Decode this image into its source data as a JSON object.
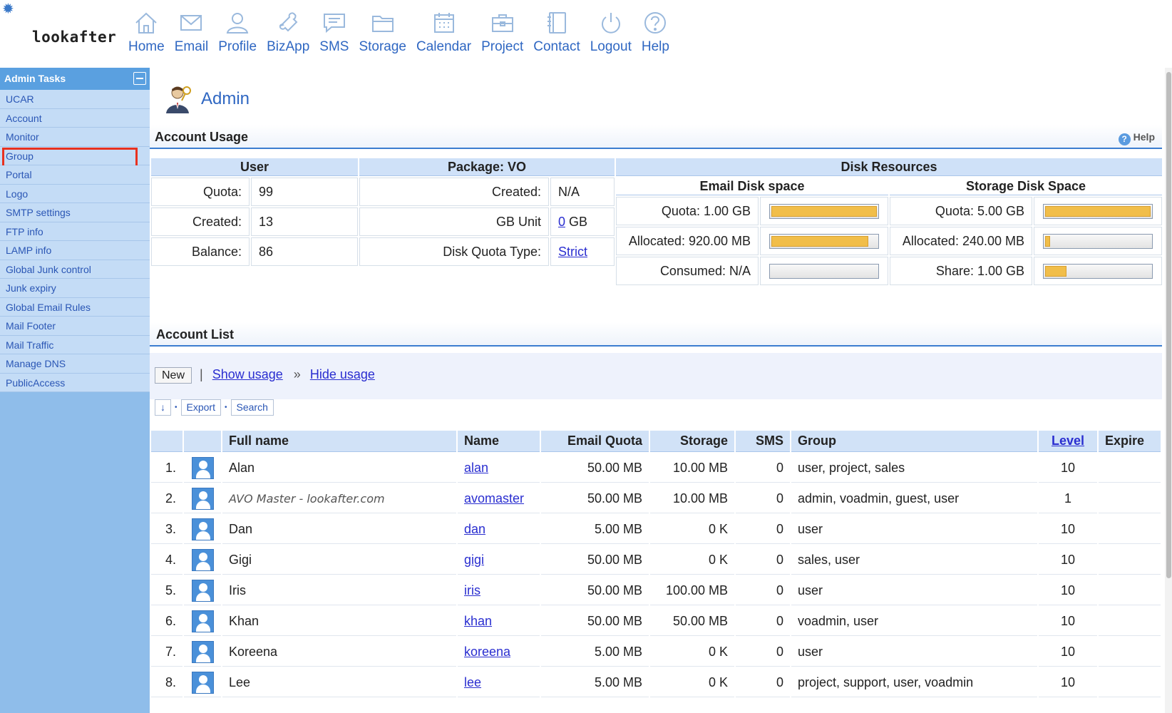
{
  "app": {
    "logo": "lookafter"
  },
  "nav": [
    {
      "label": "Home",
      "icon": "home-icon"
    },
    {
      "label": "Email",
      "icon": "envelope-icon"
    },
    {
      "label": "Profile",
      "icon": "user-icon"
    },
    {
      "label": "BizApp",
      "icon": "puzzle-icon"
    },
    {
      "label": "SMS",
      "icon": "chat-icon"
    },
    {
      "label": "Storage",
      "icon": "folder-icon"
    },
    {
      "label": "Calendar",
      "icon": "calendar-icon"
    },
    {
      "label": "Project",
      "icon": "briefcase-icon"
    },
    {
      "label": "Contact",
      "icon": "address-book-icon"
    },
    {
      "label": "Logout",
      "icon": "power-icon"
    },
    {
      "label": "Help",
      "icon": "question-icon"
    }
  ],
  "sidebar": {
    "title": "Admin Tasks",
    "items": [
      "UCAR",
      "Account",
      "Monitor",
      "Group",
      "Portal",
      "Logo",
      "SMTP settings",
      "FTP info",
      "LAMP info",
      "Global Junk control",
      "Junk expiry",
      "Global Email Rules",
      "Mail Footer",
      "Mail Traffic",
      "Manage DNS",
      "PublicAccess"
    ],
    "highlighted": "Group"
  },
  "page": {
    "title": "Admin"
  },
  "usage": {
    "section_title": "Account Usage",
    "help_label": "Help",
    "user": {
      "header": "User",
      "rows": [
        {
          "label": "Quota:",
          "value": "99"
        },
        {
          "label": "Created:",
          "value": "13"
        },
        {
          "label": "Balance:",
          "value": "86"
        }
      ]
    },
    "package": {
      "header": "Package: VO",
      "created_label": "Created:",
      "created_value": "N/A",
      "gb_label": "GB Unit",
      "gb_link": "0",
      "gb_suffix": " GB",
      "quota_type_label": "Disk Quota Type:",
      "quota_type_value": "Strict"
    },
    "disk": {
      "header": "Disk Resources",
      "email": {
        "header": "Email Disk space",
        "rows": [
          {
            "label": "Quota: 1.00 GB",
            "fill": 1.0
          },
          {
            "label": "Allocated: 920.00 MB",
            "fill": 0.92
          },
          {
            "label": "Consumed: N/A",
            "fill": 0
          }
        ]
      },
      "storage": {
        "header": "Storage Disk Space",
        "rows": [
          {
            "label": "Quota: 5.00 GB",
            "fill": 1.0
          },
          {
            "label": "Allocated: 240.00 MB",
            "fill": 0.05
          },
          {
            "label": "Share: 1.00 GB",
            "fill": 0.2
          }
        ]
      }
    }
  },
  "accounts": {
    "section_title": "Account List",
    "new_label": "New",
    "pipe": "|",
    "show_usage": "Show usage",
    "arrow": "»",
    "hide_usage": "Hide usage",
    "sort_arrow": "↓",
    "export_label": "Export",
    "search_label": "Search",
    "columns": [
      "",
      "",
      "Full name",
      "Name",
      "Email Quota",
      "Storage",
      "SMS",
      "Group",
      "Level",
      "Expire"
    ],
    "rows": [
      {
        "no": "1.",
        "full": "Alan",
        "name": "alan",
        "quota": "50.00 MB",
        "storage": "10.00 MB",
        "sms": "0",
        "group": "user, project, sales",
        "level": "10",
        "expire": ""
      },
      {
        "no": "2.",
        "full": "AVO Master - lookafter.com",
        "name": "avomaster",
        "quota": "50.00 MB",
        "storage": "10.00 MB",
        "sms": "0",
        "group": "admin, voadmin, guest, user",
        "level": "1",
        "expire": "",
        "italic": true
      },
      {
        "no": "3.",
        "full": "Dan",
        "name": "dan",
        "quota": "5.00 MB",
        "storage": "0 K",
        "sms": "0",
        "group": "user",
        "level": "10",
        "expire": ""
      },
      {
        "no": "4.",
        "full": "Gigi",
        "name": "gigi",
        "quota": "50.00 MB",
        "storage": "0 K",
        "sms": "0",
        "group": "sales, user",
        "level": "10",
        "expire": ""
      },
      {
        "no": "5.",
        "full": "Iris",
        "name": "iris",
        "quota": "50.00 MB",
        "storage": "100.00 MB",
        "sms": "0",
        "group": "user",
        "level": "10",
        "expire": ""
      },
      {
        "no": "6.",
        "full": "Khan",
        "name": "khan",
        "quota": "50.00 MB",
        "storage": "50.00 MB",
        "sms": "0",
        "group": "voadmin, user",
        "level": "10",
        "expire": ""
      },
      {
        "no": "7.",
        "full": "Koreena",
        "name": "koreena",
        "quota": "5.00 MB",
        "storage": "0 K",
        "sms": "0",
        "group": "user",
        "level": "10",
        "expire": ""
      },
      {
        "no": "8.",
        "full": "Lee",
        "name": "lee",
        "quota": "5.00 MB",
        "storage": "0 K",
        "sms": "0",
        "group": "project, support, user, voadmin",
        "level": "10",
        "expire": ""
      }
    ]
  }
}
